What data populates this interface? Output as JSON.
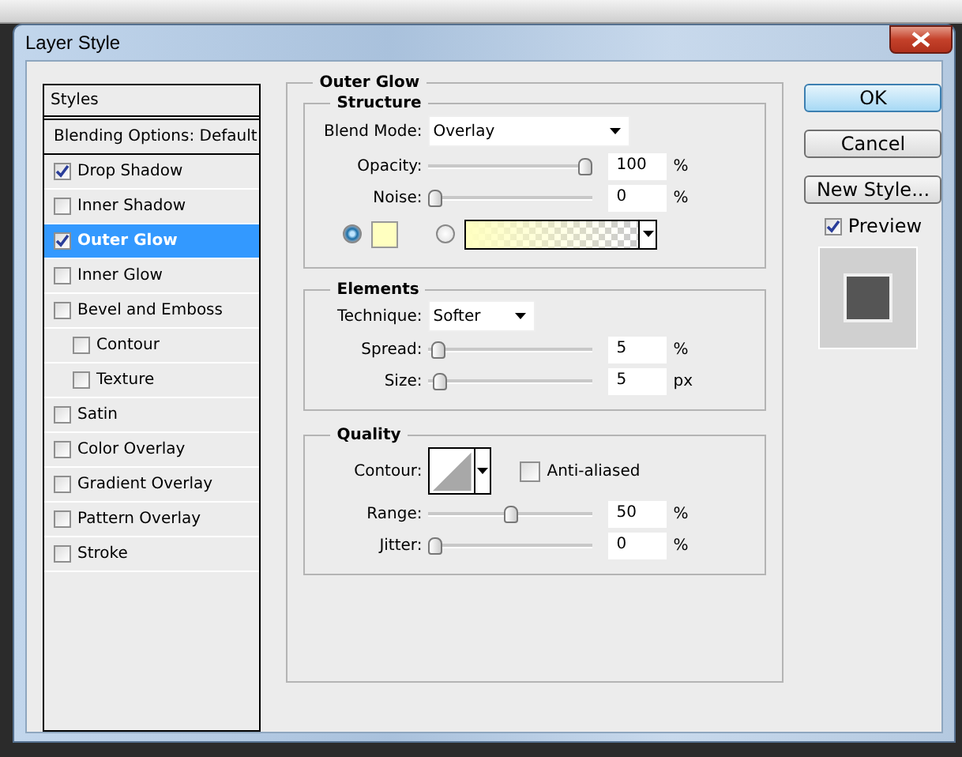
{
  "window": {
    "title": "Layer Style"
  },
  "sidebar": {
    "header": "Styles",
    "items": [
      {
        "label": "Blending Options: Default",
        "kind": "header",
        "selected": false
      },
      {
        "label": "Drop Shadow",
        "kind": "check",
        "checked": true,
        "selected": false
      },
      {
        "label": "Inner Shadow",
        "kind": "check",
        "checked": false,
        "selected": false
      },
      {
        "label": "Outer Glow",
        "kind": "check",
        "checked": true,
        "selected": true
      },
      {
        "label": "Inner Glow",
        "kind": "check",
        "checked": false,
        "selected": false
      },
      {
        "label": "Bevel and Emboss",
        "kind": "check",
        "checked": false,
        "selected": false,
        "children": [
          {
            "label": "Contour",
            "kind": "check",
            "checked": false,
            "selected": false
          },
          {
            "label": "Texture",
            "kind": "check",
            "checked": false,
            "selected": false
          }
        ]
      },
      {
        "label": "Satin",
        "kind": "check",
        "checked": false,
        "selected": false
      },
      {
        "label": "Color Overlay",
        "kind": "check",
        "checked": false,
        "selected": false
      },
      {
        "label": "Gradient Overlay",
        "kind": "check",
        "checked": false,
        "selected": false
      },
      {
        "label": "Pattern Overlay",
        "kind": "check",
        "checked": false,
        "selected": false
      },
      {
        "label": "Stroke",
        "kind": "check",
        "checked": false,
        "selected": false
      }
    ]
  },
  "panel": {
    "title": "Outer Glow",
    "structure": {
      "title": "Structure",
      "blend_mode": {
        "label": "Blend Mode:",
        "value": "Overlay"
      },
      "sliders": [
        {
          "label": "Opacity:",
          "level": 1,
          "value": "100",
          "unit": "%"
        },
        {
          "label": "Noise:",
          "level": 0,
          "value": "0",
          "unit": "%"
        }
      ],
      "fill_options": [
        {
          "kind": "color",
          "selected": true,
          "color": "#ffffc0"
        },
        {
          "kind": "gradient",
          "selected": false,
          "color": "#ffffc0"
        }
      ]
    },
    "elements": {
      "title": "Elements",
      "technique": {
        "label": "Technique:",
        "value": "Softer"
      },
      "sliders": [
        {
          "label": "Spread:",
          "level": 0.02,
          "value": "5",
          "unit": "%"
        },
        {
          "label": "Size:",
          "level": 0.03,
          "value": "5",
          "unit": "px"
        }
      ]
    },
    "quality": {
      "title": "Quality",
      "contour_label": "Contour:",
      "anti_aliased": {
        "label": "Anti-aliased",
        "checked": false
      },
      "sliders": [
        {
          "label": "Range:",
          "level": 0.5,
          "value": "50",
          "unit": "%"
        },
        {
          "label": "Jitter:",
          "level": 0,
          "value": "0",
          "unit": "%"
        }
      ]
    }
  },
  "buttons": [
    {
      "label": "OK",
      "default": true
    },
    {
      "label": "Cancel",
      "default": false
    },
    {
      "label": "New Style...",
      "default": false
    }
  ],
  "preview": {
    "label": "Preview",
    "checked": true
  }
}
